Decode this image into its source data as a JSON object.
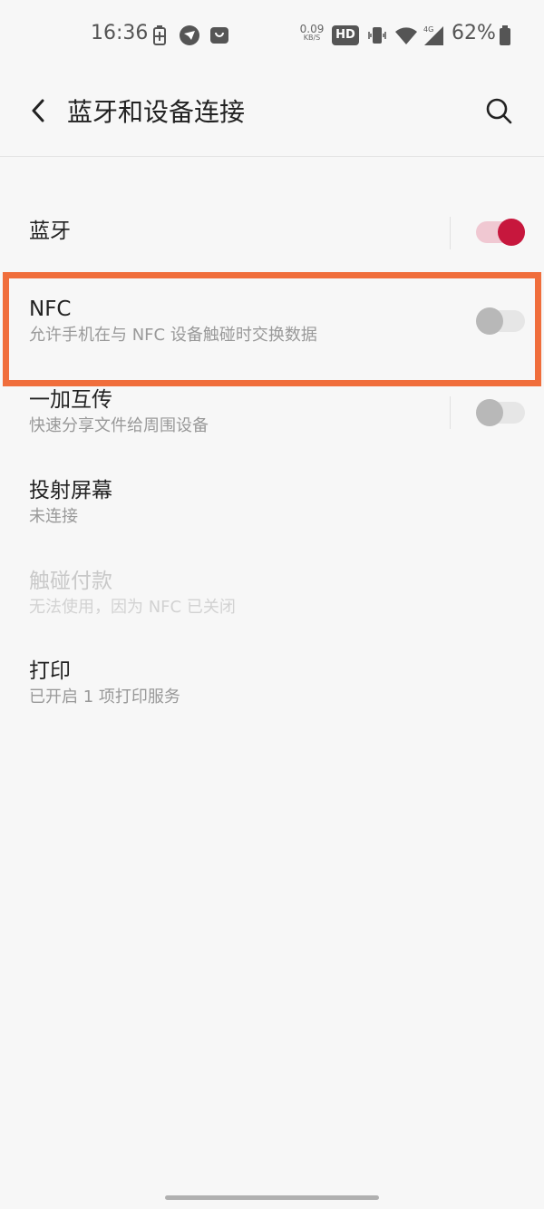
{
  "status_bar": {
    "time": "16:36",
    "net_speed_value": "0.09",
    "net_speed_unit": "KB/S",
    "hd_label": "HD",
    "network_label": "4G",
    "battery_percent": "62%",
    "icons": [
      "battery-charging-icon",
      "app-bird-icon",
      "shopping-bag-icon",
      "vibrate-icon",
      "wifi-icon",
      "cellular-signal-icon",
      "battery-icon"
    ]
  },
  "header": {
    "title": "蓝牙和设备连接",
    "back_icon": "chevron-left-icon",
    "search_icon": "search-icon"
  },
  "settings": [
    {
      "id": "bluetooth",
      "title": "蓝牙",
      "subtitle": "",
      "toggle": true,
      "enabled": true
    },
    {
      "id": "nfc",
      "title": "NFC",
      "subtitle": "允许手机在与 NFC 设备触碰时交换数据",
      "toggle": false,
      "enabled": true,
      "highlighted": true
    },
    {
      "id": "oneplus-share",
      "title": "一加互传",
      "subtitle": "快速分享文件给周围设备",
      "toggle": false,
      "enabled": true
    },
    {
      "id": "screen-cast",
      "title": "投射屏幕",
      "subtitle": "未连接",
      "enabled": true
    },
    {
      "id": "tap-pay",
      "title": "触碰付款",
      "subtitle": "无法使用，因为 NFC 已关闭",
      "enabled": false
    },
    {
      "id": "print",
      "title": "打印",
      "subtitle": "已开启 1 项打印服务",
      "enabled": true
    }
  ],
  "colors": {
    "accent": "#c7173d",
    "highlight": "#f06e3c",
    "background": "#f7f7f7"
  }
}
